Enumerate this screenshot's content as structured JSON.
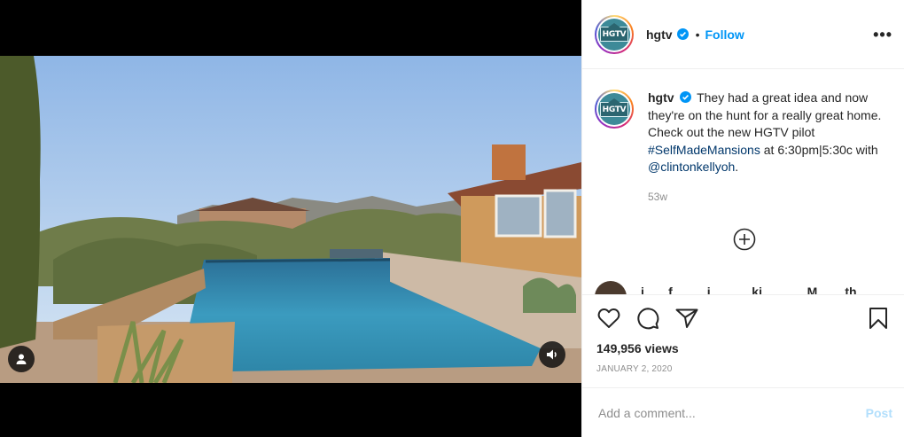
{
  "post": {
    "username": "hgtv",
    "follow_label": "Follow",
    "dot": "•",
    "more_label": "•••",
    "avatar_text": "HGTV"
  },
  "caption": {
    "username": "hgtv",
    "text_part1": "They had a great idea and now they're on the hunt for a really great home. Check out the new HGTV pilot ",
    "hashtag": "#SelfMadeMansions",
    "text_part2": " at 6:30pm|5:30c with ",
    "mention": "@clintonkellyoh",
    "text_part3": ".",
    "time": "53w"
  },
  "next_comment": {
    "partial_text": "i _ _ f _ _ _ i _ _ _ _ki _ _ _ _ M_ _ _th _ _"
  },
  "stats": {
    "views": "149,956 views",
    "date": "JANUARY 2, 2020"
  },
  "comment_box": {
    "placeholder": "Add a comment...",
    "post_label": "Post"
  },
  "icons": {
    "like": "heart-icon",
    "comment": "comment-icon",
    "share": "share-icon",
    "save": "bookmark-icon",
    "load_more": "plus-circle-icon",
    "tag": "user-tag-icon",
    "sound": "speaker-icon"
  },
  "colors": {
    "accent": "#0095f6",
    "post_disabled": "#b2dffc",
    "muted": "#8e8e8e",
    "link": "#00376b"
  }
}
